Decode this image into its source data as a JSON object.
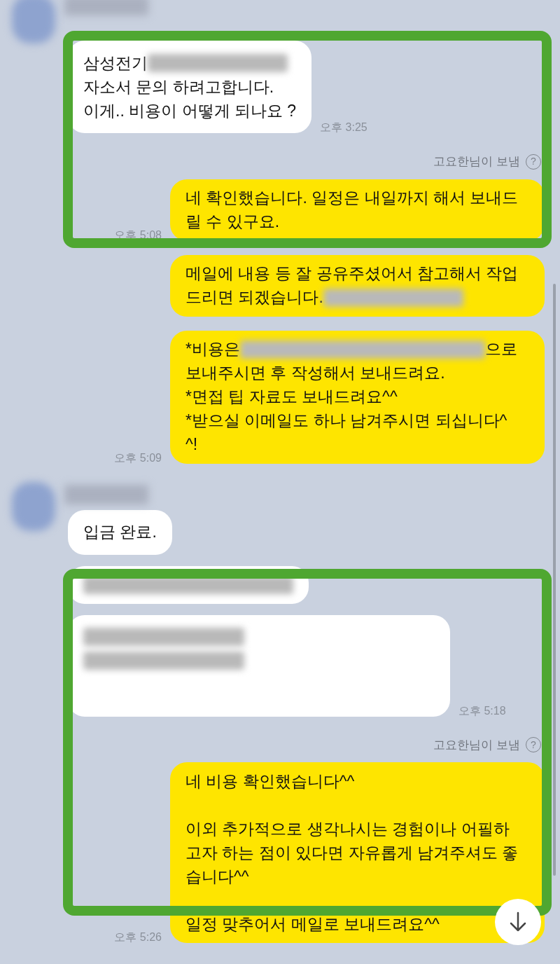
{
  "messages": [
    {
      "kind": "sender"
    },
    {
      "kind": "incoming",
      "paragraphs": [
        [
          [
            {
              "text": "삼성전기"
            },
            {
              "kind": "redacted"
            }
          ],
          [
            {
              "text": "자소서 문의 하려고합니다."
            }
          ],
          [
            {
              "text": "이게.. 비용이 어떻게 되나요 ?"
            }
          ]
        ]
      ],
      "time": "오후 3:25"
    },
    {
      "kind": "note",
      "text": "고요한님이 보냄",
      "help": "?"
    },
    {
      "kind": "outgoing",
      "paragraphs": [
        [
          [
            {
              "text": "네 확인했습니다. 일정은 내일까지 해서 보내드"
            }
          ],
          [
            {
              "text": "릴 수 있구요."
            }
          ]
        ]
      ],
      "time": "오후 5:08"
    },
    {
      "kind": "outgoing",
      "paragraphs": [
        [
          [
            {
              "text": "메일에 내용 등 잘 공유주셨어서 참고해서 작업"
            }
          ],
          [
            {
              "text": "드리면 되겠습니다."
            },
            {
              "kind": "redacted"
            }
          ]
        ]
      ]
    },
    {
      "kind": "outgoing",
      "paragraphs": [
        [
          [
            {
              "text": "*비용은"
            },
            {
              "kind": "redacted"
            },
            {
              "text": "으로"
            }
          ],
          [
            {
              "text": "보내주시면 후 작성해서 보내드려요."
            }
          ],
          [
            {
              "text": "*면접 팁 자료도 보내드려요^^"
            }
          ],
          [
            {
              "text": "*받으실 이메일도 하나 남겨주시면 되십니다^"
            }
          ],
          [
            {
              "text": "^!"
            }
          ]
        ]
      ],
      "time": "오후 5:09"
    },
    {
      "kind": "sender"
    },
    {
      "kind": "incoming",
      "paragraphs": [
        [
          [
            {
              "text": "입금 완료."
            }
          ]
        ]
      ]
    },
    {
      "kind": "incoming",
      "paragraphs": [
        [
          [
            {
              "kind": "redacted"
            }
          ]
        ]
      ]
    },
    {
      "kind": "incoming",
      "wide": true,
      "paragraphs": [
        [
          [
            {
              "kind": "redacted"
            }
          ],
          [
            {
              "kind": "redacted"
            }
          ]
        ]
      ],
      "time": "오후 5:18"
    },
    {
      "kind": "note",
      "text": "고요한님이 보냄",
      "help": "?"
    },
    {
      "kind": "outgoing",
      "paragraphs": [
        [
          [
            {
              "text": "네 비용 확인했습니다^^"
            }
          ]
        ],
        [
          [
            {
              "text": "이외 추가적으로 생각나시는 경험이나 어필하"
            }
          ],
          [
            {
              "text": "고자 하는 점이 있다면 자유롭게 남겨주셔도 좋"
            }
          ],
          [
            {
              "text": "습니다^^"
            }
          ]
        ],
        [
          [
            {
              "text": "일정 맞추어서 메일로 보내드려요^^"
            }
          ]
        ]
      ],
      "time": "오후 5:26"
    }
  ]
}
